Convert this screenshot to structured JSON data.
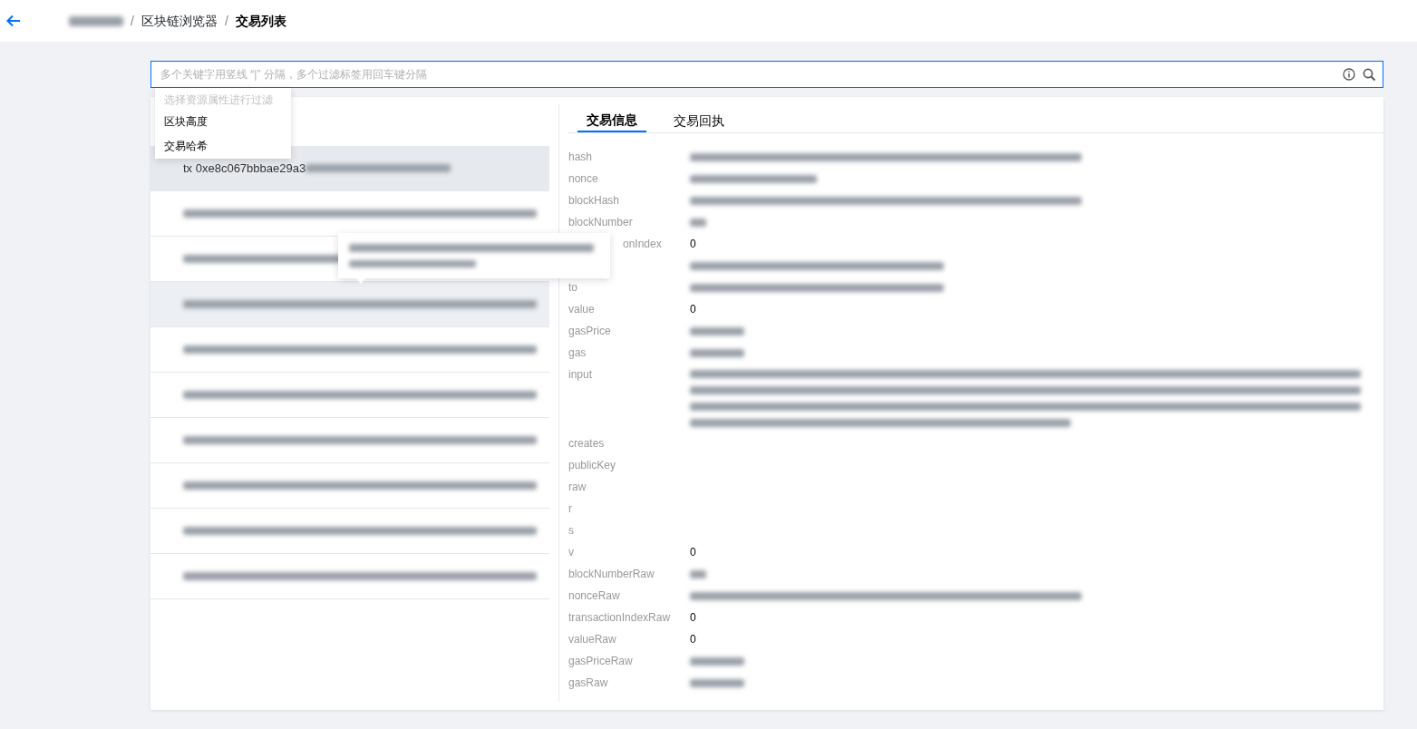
{
  "header": {
    "separator": "/",
    "breadcrumb": [
      {
        "kind": "redacted"
      },
      {
        "kind": "text",
        "text": "区块链浏览器"
      },
      {
        "kind": "current",
        "text": "交易列表"
      }
    ]
  },
  "search": {
    "placeholder": "多个关键字用竖线 “|” 分隔，多个过滤标签用回车键分隔",
    "focused": true
  },
  "filter_menu": {
    "header": "选择资源属性进行过滤",
    "items": [
      {
        "label": "区块高度"
      },
      {
        "label": "交易哈希"
      }
    ]
  },
  "transactions": [
    {
      "text": "tx 0xe8c067bbbae29a3",
      "selected": true,
      "hovered": false
    },
    {
      "selected": false,
      "hovered": false
    },
    {
      "selected": false,
      "hovered": false
    },
    {
      "selected": false,
      "hovered": true
    },
    {
      "selected": false,
      "hovered": false
    },
    {
      "selected": false,
      "hovered": false
    },
    {
      "selected": false,
      "hovered": false
    },
    {
      "selected": false,
      "hovered": false
    },
    {
      "selected": false,
      "hovered": false
    },
    {
      "selected": false,
      "hovered": false
    }
  ],
  "tabs": [
    {
      "label": "交易信息",
      "selected": true
    },
    {
      "label": "交易回执",
      "selected": false
    }
  ],
  "fields": [
    {
      "label": "hash",
      "kind": "redacted_long"
    },
    {
      "label": "nonce",
      "kind": "redacted_mid"
    },
    {
      "label": "blockHash",
      "kind": "redacted_long"
    },
    {
      "label": "blockNumber",
      "kind": "redacted_tiny"
    },
    {
      "label": "onIndex",
      "covered": true,
      "kind": "text",
      "value": "0"
    },
    {
      "kind": "redacted_wide"
    },
    {
      "label": "to",
      "kind": "redacted_wide"
    },
    {
      "label": "value",
      "kind": "text",
      "value": "0"
    },
    {
      "label": "gasPrice",
      "kind": "redacted_short"
    },
    {
      "label": "gas",
      "kind": "redacted_short"
    },
    {
      "label": "input",
      "kind": "redacted_block"
    },
    {
      "label": "creates",
      "kind": "empty"
    },
    {
      "label": "publicKey",
      "kind": "empty"
    },
    {
      "label": "raw",
      "kind": "empty"
    },
    {
      "label": "r",
      "kind": "empty"
    },
    {
      "label": "s",
      "kind": "empty"
    },
    {
      "label": "v",
      "kind": "text",
      "value": "0"
    },
    {
      "label": "blockNumberRaw",
      "kind": "redacted_tiny"
    },
    {
      "label": "nonceRaw",
      "kind": "redacted_long"
    },
    {
      "label": "transactionIndexRaw",
      "kind": "text",
      "value": "0"
    },
    {
      "label": "valueRaw",
      "kind": "text",
      "value": "0"
    },
    {
      "label": "gasPriceRaw",
      "kind": "redacted_short"
    },
    {
      "label": "gasRaw",
      "kind": "redacted_short"
    }
  ]
}
